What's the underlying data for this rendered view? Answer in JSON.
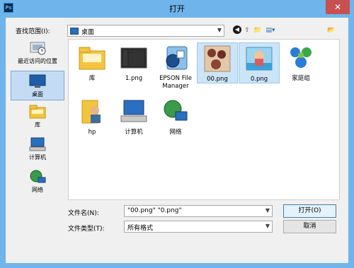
{
  "window": {
    "title": "打开",
    "app_icon": "Ps",
    "close_glyph": "✕"
  },
  "lookin": {
    "label": "查找范围(I):",
    "value": "桌面"
  },
  "toolbar": {
    "back": "◀",
    "up": "⇧",
    "new_folder": "📁",
    "view": "▤▾",
    "far_right": "📂"
  },
  "places": [
    {
      "label": "最近访问的位置",
      "icon": "recent-places-icon"
    },
    {
      "label": "桌面",
      "icon": "desktop-icon",
      "selected": true
    },
    {
      "label": "库",
      "icon": "library-icon"
    },
    {
      "label": "计算机",
      "icon": "computer-icon"
    },
    {
      "label": "网络",
      "icon": "network-icon"
    }
  ],
  "files": [
    {
      "label": "库",
      "icon": "library-folder-icon",
      "selected": false
    },
    {
      "label": "1.png",
      "icon": "image-thumbnail-icon",
      "selected": false
    },
    {
      "label": "EPSON File Manager",
      "icon": "epson-app-icon",
      "selected": false
    },
    {
      "label": "00.png",
      "icon": "image-thumbnail-icon",
      "selected": true
    },
    {
      "label": "0.png",
      "icon": "image-thumbnail-icon",
      "selected": true
    },
    {
      "label": "家庭组",
      "icon": "homegroup-icon",
      "selected": false
    },
    {
      "label": "hp",
      "icon": "user-folder-icon",
      "selected": false
    },
    {
      "label": "计算机",
      "icon": "computer-icon",
      "selected": false
    },
    {
      "label": "网络",
      "icon": "network-icon",
      "selected": false
    }
  ],
  "filename": {
    "label": "文件名(N):",
    "value": "\"00.png\" \"0.png\""
  },
  "filetype": {
    "label": "文件类型(T):",
    "value": "所有格式"
  },
  "buttons": {
    "open": "打开(O)",
    "cancel": "取消"
  }
}
